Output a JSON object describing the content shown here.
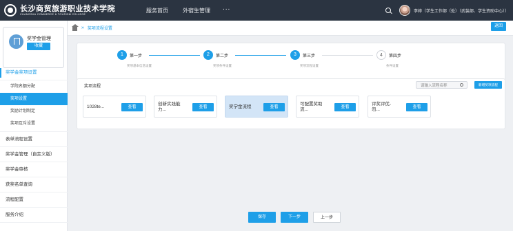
{
  "header": {
    "logo_text": "长沙商贸旅游职业技术学院",
    "logo_subtext": "CHANGSHA COMMERCE & TOURISM COLLEGE",
    "nav": [
      "服务首页",
      "外宿生管理"
    ],
    "more": "...",
    "user": "李婷（学生工作部（处）（武装部、学生资助中心））"
  },
  "sidebar": {
    "card_title": "奖学金管理",
    "card_button": "收藏",
    "menu": [
      {
        "label": "奖学金奖项设置",
        "open": true,
        "children": [
          "学院名额分配",
          "奖项设置",
          "奖励计划制定",
          "奖项互斥设置"
        ],
        "active_child": 1
      },
      {
        "label": "表单流程设置"
      },
      {
        "label": "奖学金管理（自定义版）"
      },
      {
        "label": "奖学金审核"
      },
      {
        "label": "获奖名单查询"
      },
      {
        "label": "流程配置"
      },
      {
        "label": "服务介绍"
      }
    ]
  },
  "breadcrumb": {
    "sep": "»",
    "current": "奖项流程设置"
  },
  "back_button": "返回",
  "steps": [
    {
      "num": "1",
      "title": "第一步",
      "desc": "奖项基本信息设置",
      "done": true
    },
    {
      "num": "2",
      "title": "第二步",
      "desc": "奖项条件设置",
      "done": true
    },
    {
      "num": "3",
      "title": "第三步",
      "desc": "奖项流程设置",
      "done": true
    },
    {
      "num": "4",
      "title": "第四步",
      "desc": "条件设置",
      "done": false
    }
  ],
  "flow": {
    "title": "奖项流程",
    "search_placeholder": "请输入流程名称",
    "new_button": "新增奖项流程",
    "view_label": "查看",
    "cards": [
      {
        "name": "1028te..."
      },
      {
        "name": "创新实践能力..."
      },
      {
        "name": "奖学金流程",
        "selected": true
      },
      {
        "name": "可配置奖助流..."
      },
      {
        "name": "评奖评优-勿..."
      }
    ]
  },
  "footer": {
    "save": "保存",
    "next": "下一步",
    "prev": "上一步"
  },
  "colors": {
    "primary": "#1e9fe8",
    "header_bg": "#2b3441",
    "selected_card": "#d3e5f7"
  }
}
